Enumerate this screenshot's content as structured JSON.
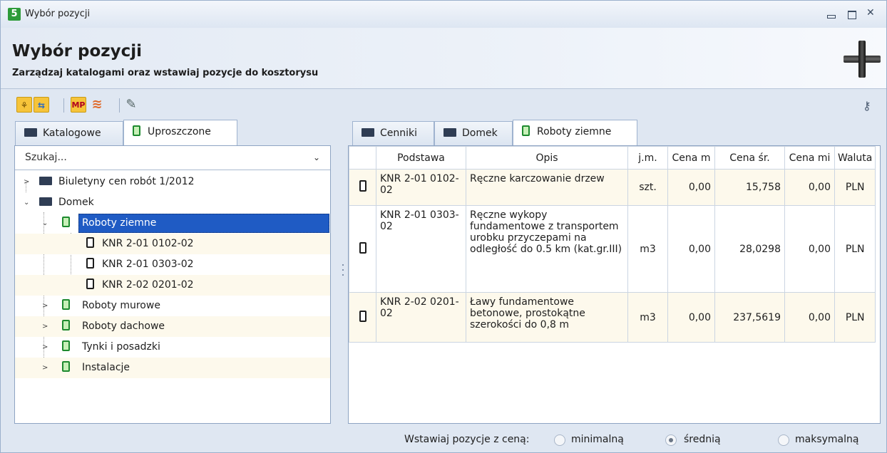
{
  "window": {
    "title": "Wybór pozycji",
    "app_icon": "5"
  },
  "header": {
    "title": "Wybór pozycji",
    "subtitle": "Zarządzaj katalogami oraz wstawiaj pozycje do kosztorysu"
  },
  "toolbar": {
    "buttons": [
      {
        "icon": "tree-grid-icon"
      },
      {
        "icon": "swap-arrows-icon"
      },
      {
        "icon": "mp-icon",
        "label": "MP"
      },
      {
        "icon": "coins-icon"
      },
      {
        "icon": "edit-pencil-icon"
      }
    ],
    "key_icon": "key-icon"
  },
  "left_tabs": [
    {
      "label": "Katalogowe",
      "active": false
    },
    {
      "label": "Uproszczone",
      "active": true
    }
  ],
  "search": {
    "placeholder": "Szukaj..."
  },
  "tree": {
    "nodes": [
      {
        "label": "Biuletyny cen robót 1/2012",
        "level": 0
      },
      {
        "label": "Domek",
        "level": 0
      },
      {
        "label": "Roboty ziemne",
        "level": 1,
        "selected": true
      },
      {
        "label": "KNR 2-01 0102-02",
        "level": 2
      },
      {
        "label": "KNR 2-01 0303-02",
        "level": 2
      },
      {
        "label": "KNR 2-02 0201-02",
        "level": 2
      },
      {
        "label": "Roboty murowe",
        "level": 1
      },
      {
        "label": "Roboty dachowe",
        "level": 1
      },
      {
        "label": "Tynki i posadzki",
        "level": 1
      },
      {
        "label": "Instalacje",
        "level": 1
      }
    ]
  },
  "right_tabs": [
    {
      "label": "Cenniki",
      "active": false
    },
    {
      "label": "Domek",
      "active": false
    },
    {
      "label": "Roboty ziemne",
      "active": true
    }
  ],
  "grid": {
    "columns": [
      "Podstawa",
      "Opis",
      "j.m.",
      "Cena m",
      "Cena śr.",
      "Cena mi",
      "Waluta"
    ],
    "rows": [
      {
        "podstawa": "KNR 2-01 0102-02",
        "opis": "Ręczne karczowanie drzew",
        "jm": "szt.",
        "cena_min": "0,00",
        "cena_sr": "15,758",
        "cena_max": "0,00",
        "waluta": "PLN"
      },
      {
        "podstawa": "KNR 2-01 0303-02",
        "opis": "Ręczne wykopy fundamentowe z transportem urobku przyczepami  na odległość do 0.5 km (kat.gr.III)",
        "jm": "m3",
        "cena_min": "0,00",
        "cena_sr": "28,0298",
        "cena_max": "0,00",
        "waluta": "PLN"
      },
      {
        "podstawa": "KNR 2-02 0201-02",
        "opis": "Ławy fundamentowe betonowe, prostokątne szerokości do 0,8 m",
        "jm": "m3",
        "cena_min": "0,00",
        "cena_sr": "237,5619",
        "cena_max": "0,00",
        "waluta": "PLN"
      }
    ]
  },
  "footer": {
    "label": "Wstawiaj pozycje z ceną:",
    "options": [
      {
        "label": "minimalną",
        "checked": false
      },
      {
        "label": "średnią",
        "checked": true
      },
      {
        "label": "maksymalną",
        "checked": false
      }
    ]
  }
}
